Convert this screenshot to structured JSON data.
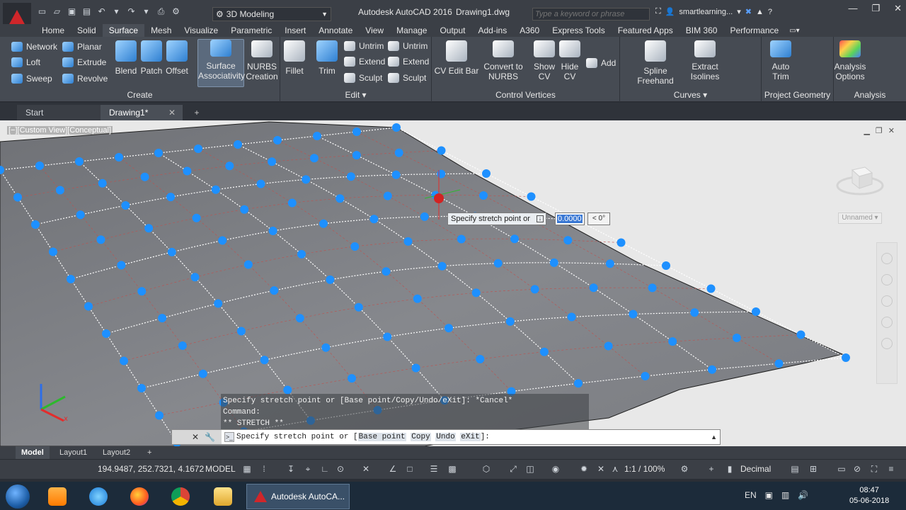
{
  "titlebar": {
    "workspace": "3D Modeling",
    "app_title": "Autodesk AutoCAD 2016",
    "doc_title": "Drawing1.dwg",
    "search_placeholder": "Type a keyword or phrase",
    "user": "smartlearning..."
  },
  "ribbon_tabs": [
    "Home",
    "Solid",
    "Surface",
    "Mesh",
    "Visualize",
    "Parametric",
    "Insert",
    "Annotate",
    "View",
    "Manage",
    "Output",
    "Add-ins",
    "A360",
    "Express Tools",
    "Featured Apps",
    "BIM 360",
    "Performance"
  ],
  "ribbon_active_tab": "Surface",
  "panels": {
    "create": {
      "title": "Create",
      "small": [
        "Network",
        "Loft",
        "Sweep",
        "Planar",
        "Extrude",
        "Revolve"
      ],
      "big": [
        "Blend",
        "Patch",
        "Offset"
      ],
      "active_big_line1": "Surface",
      "active_big_line2": "Associativity",
      "nurbs_line1": "NURBS",
      "nurbs_line2": "Creation"
    },
    "edit": {
      "title": "Edit",
      "big": [
        "Fillet",
        "Trim"
      ],
      "small": [
        "Untrim",
        "Extend",
        "Sculpt",
        "Untrim",
        "Extend",
        "Sculpt"
      ]
    },
    "cv": {
      "title": "Control Vertices",
      "cv_edit_bar": "CV Edit Bar",
      "convert_line1": "Convert to",
      "convert_line2": "NURBS",
      "show_line1": "Show",
      "show_line2": "CV",
      "hide_line1": "Hide",
      "hide_line2": "CV",
      "add": "Add"
    },
    "curves": {
      "title": "Curves",
      "spline": "Spline Freehand",
      "extract_line1": "Extract",
      "extract_line2": "Isolines"
    },
    "project": {
      "title": "Project Geometry",
      "auto_line1": "Auto",
      "auto_line2": "Trim"
    },
    "analysis": {
      "title": "Analysis",
      "options_line1": "Analysis",
      "options_line2": "Options"
    }
  },
  "file_tabs": {
    "start": "Start",
    "drawing": "Drawing1*"
  },
  "viewport": {
    "label": "[−][Custom View][Conceptual]",
    "wcs": "Unnamed"
  },
  "dynamic_input": {
    "prompt": "Specify stretch point or",
    "value": "0.0000",
    "angle": "< 0°"
  },
  "command_history": [
    "Specify stretch point or [Base point/Copy/Undo/eXit]: *Cancel*",
    "Command:",
    "** STRETCH **"
  ],
  "command_line": {
    "prefix": "Specify stretch point or [",
    "opt1": "Base point",
    "opt2": "Copy",
    "opt3": "Undo",
    "opt4": "eXit",
    "suffix": "]:"
  },
  "layout_tabs": [
    "Model",
    "Layout1",
    "Layout2"
  ],
  "statusbar": {
    "coords": "194.9487, 252.7321, 4.1672",
    "model": "MODEL",
    "scale": "1:1 / 100%",
    "units": "Decimal"
  },
  "taskbar": {
    "autocad_label": "Autodesk AutoCA...",
    "lang": "EN",
    "time": "08:47",
    "date": "05-06-2018"
  },
  "colors": {
    "cv_point": "#1e90ff",
    "surface": "#7d7f84",
    "accent_red": "#d0262a"
  }
}
